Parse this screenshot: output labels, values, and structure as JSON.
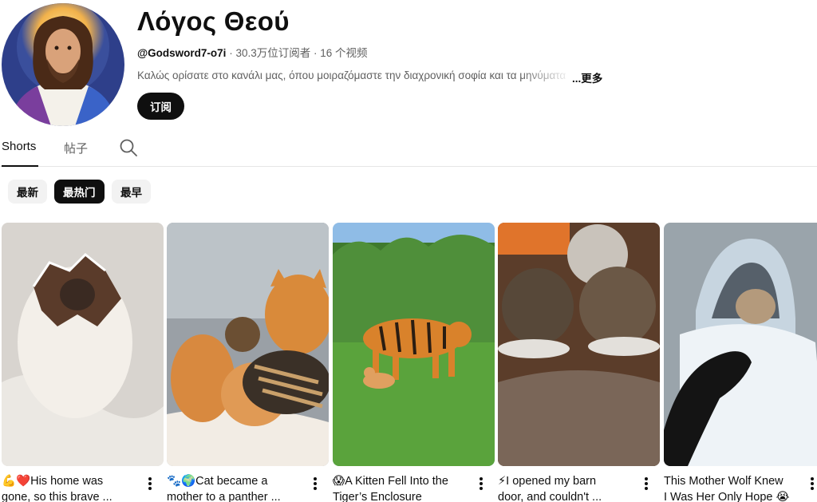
{
  "channel": {
    "name": "Λόγος Θεού",
    "handle": "@Godsword7-o7i",
    "subscribers": "30.3万位订阅者",
    "videos": "16 个视频",
    "description": "Καλώς ορίσατε στο κανάλι μας, όπου μοιραζόμαστε την διαχρονική σοφία και τα μηνύματα",
    "more": "...更多",
    "subscribe": "订阅"
  },
  "tabs": [
    {
      "label": "Shorts",
      "active": true
    },
    {
      "label": "帖子",
      "active": false
    }
  ],
  "chips": [
    {
      "label": "最新",
      "active": false
    },
    {
      "label": "最热门",
      "active": true
    },
    {
      "label": "最早",
      "active": false
    }
  ],
  "shorts": [
    {
      "title_line1": "💪❤️His home was",
      "title_line2": "gone, so this brave ..."
    },
    {
      "title_line1": "🐾🌍Cat became a",
      "title_line2": "mother to a panther ..."
    },
    {
      "title_line1": "😱A Kitten Fell Into the",
      "title_line2": "Tiger’s Enclosure"
    },
    {
      "title_line1": "⚡I opened my barn",
      "title_line2": "door, and couldn't ..."
    },
    {
      "title_line1": "This Mother Wolf Knew",
      "title_line2": "I Was Her Only Hope 😭"
    }
  ],
  "icons": {
    "search": "search-icon",
    "more": "more-vert-icon"
  }
}
